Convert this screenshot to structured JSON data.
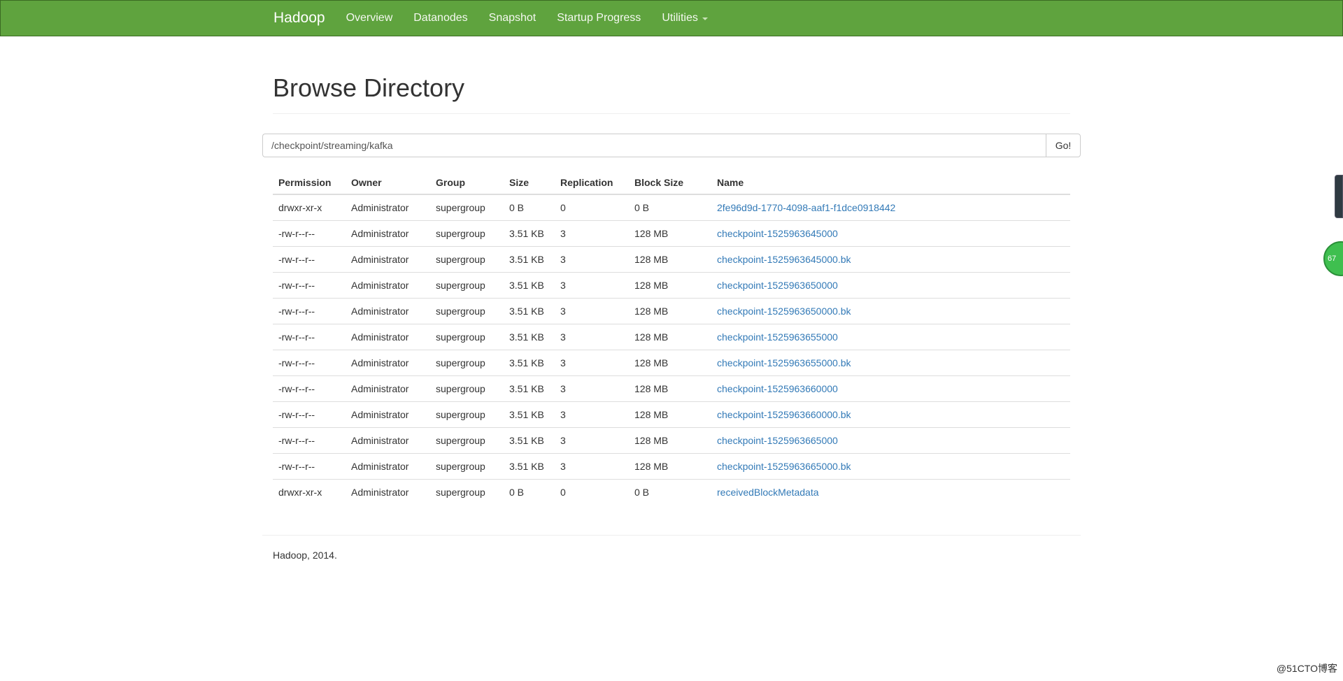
{
  "navbar": {
    "brand": "Hadoop",
    "links": [
      "Overview",
      "Datanodes",
      "Snapshot",
      "Startup Progress",
      "Utilities"
    ]
  },
  "page": {
    "title": "Browse Directory",
    "path_value": "/checkpoint/streaming/kafka",
    "go_label": "Go!"
  },
  "table": {
    "headers": [
      "Permission",
      "Owner",
      "Group",
      "Size",
      "Replication",
      "Block Size",
      "Name"
    ],
    "rows": [
      [
        "drwxr-xr-x",
        "Administrator",
        "supergroup",
        "0 B",
        "0",
        "0 B",
        "2fe96d9d-1770-4098-aaf1-f1dce0918442"
      ],
      [
        "-rw-r--r--",
        "Administrator",
        "supergroup",
        "3.51 KB",
        "3",
        "128 MB",
        "checkpoint-1525963645000"
      ],
      [
        "-rw-r--r--",
        "Administrator",
        "supergroup",
        "3.51 KB",
        "3",
        "128 MB",
        "checkpoint-1525963645000.bk"
      ],
      [
        "-rw-r--r--",
        "Administrator",
        "supergroup",
        "3.51 KB",
        "3",
        "128 MB",
        "checkpoint-1525963650000"
      ],
      [
        "-rw-r--r--",
        "Administrator",
        "supergroup",
        "3.51 KB",
        "3",
        "128 MB",
        "checkpoint-1525963650000.bk"
      ],
      [
        "-rw-r--r--",
        "Administrator",
        "supergroup",
        "3.51 KB",
        "3",
        "128 MB",
        "checkpoint-1525963655000"
      ],
      [
        "-rw-r--r--",
        "Administrator",
        "supergroup",
        "3.51 KB",
        "3",
        "128 MB",
        "checkpoint-1525963655000.bk"
      ],
      [
        "-rw-r--r--",
        "Administrator",
        "supergroup",
        "3.51 KB",
        "3",
        "128 MB",
        "checkpoint-1525963660000"
      ],
      [
        "-rw-r--r--",
        "Administrator",
        "supergroup",
        "3.51 KB",
        "3",
        "128 MB",
        "checkpoint-1525963660000.bk"
      ],
      [
        "-rw-r--r--",
        "Administrator",
        "supergroup",
        "3.51 KB",
        "3",
        "128 MB",
        "checkpoint-1525963665000"
      ],
      [
        "-rw-r--r--",
        "Administrator",
        "supergroup",
        "3.51 KB",
        "3",
        "128 MB",
        "checkpoint-1525963665000.bk"
      ],
      [
        "drwxr-xr-x",
        "Administrator",
        "supergroup",
        "0 B",
        "0",
        "0 B",
        "receivedBlockMetadata"
      ]
    ]
  },
  "footer": {
    "text": "Hadoop, 2014."
  },
  "overlay": {
    "badge_text": "67",
    "watermark": "@51CTO博客"
  },
  "colors": {
    "navbar": "#5fa33e",
    "link": "#337ab7"
  }
}
